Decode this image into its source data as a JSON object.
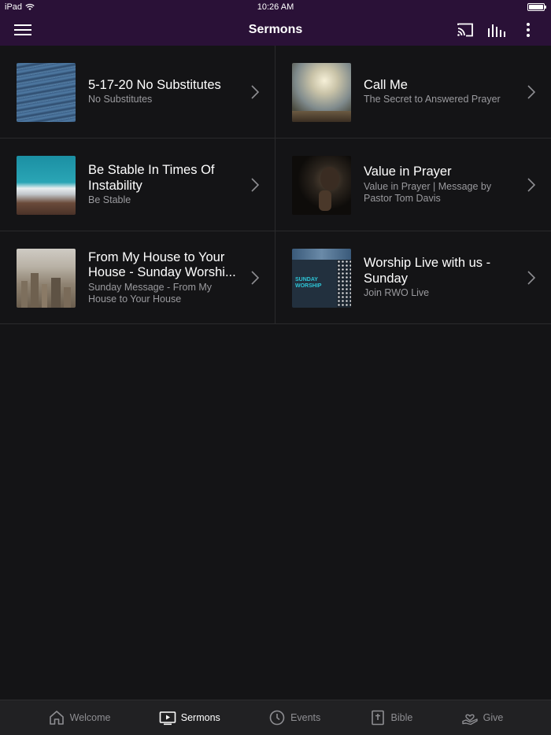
{
  "status": {
    "device": "iPad",
    "time": "10:26 AM"
  },
  "header": {
    "title": "Sermons"
  },
  "sermons": [
    {
      "title": "5-17-20 No Substitutes",
      "subtitle": "No Substitutes"
    },
    {
      "title": "Call Me",
      "subtitle": "The Secret to Answered Prayer"
    },
    {
      "title": "Be Stable In Times Of Instability",
      "subtitle": "Be Stable"
    },
    {
      "title": "Value in Prayer",
      "subtitle": "Value in Prayer | Message by Pastor Tom Davis"
    },
    {
      "title": "From My House to Your House - Sunday Worshi...",
      "subtitle": "Sunday Message - From My House to Your House"
    },
    {
      "title": "Worship Live with us - Sunday",
      "subtitle": "Join RWO Live",
      "thumb_text": "SUNDAY WORSHIP"
    }
  ],
  "tabs": [
    {
      "label": "Welcome",
      "icon": "home-icon"
    },
    {
      "label": "Sermons",
      "icon": "video-icon",
      "active": true
    },
    {
      "label": "Events",
      "icon": "clock-icon"
    },
    {
      "label": "Bible",
      "icon": "bible-icon"
    },
    {
      "label": "Give",
      "icon": "give-icon"
    }
  ],
  "colors": {
    "header": "#2a1137",
    "background": "#141416",
    "tabbar": "#212123"
  }
}
